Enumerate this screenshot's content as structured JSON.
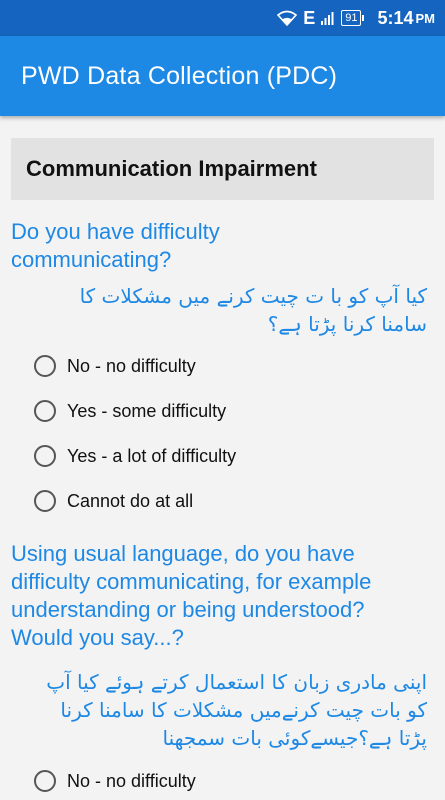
{
  "status_bar": {
    "network": "E",
    "battery": "91",
    "time": "5:14",
    "time_suffix": "PM"
  },
  "app_bar": {
    "title": "PWD Data Collection (PDC)"
  },
  "section": {
    "title": "Communication Impairment"
  },
  "questions": [
    {
      "text_line1": "Do you have difficulty",
      "text_line2": "communicating?",
      "urdu_line1": "کیا آپ کو با ت چیت کرنے میں مشکلات کا",
      "urdu_line2": "سامنا کرنا پڑتا ہے؟",
      "options": [
        "No - no difficulty",
        "Yes - some difficulty",
        "Yes - a lot of difficulty",
        "Cannot do at all"
      ]
    },
    {
      "text_line1": "Using usual language, do you have",
      "text_line2": "difficulty communicating, for example",
      "text_line3": "understanding or being understood?",
      "text_line4": "Would you say...?",
      "urdu_line1": "اپنی مادری زبان کا استعمال کرتے ہوئے کیا آپ",
      "urdu_line2": "کو بات چیت کرنےمیں مشکلات کا سامنا کرنا",
      "urdu_line3": "پڑتا ہے؟جیسےکوئی بات سمجھنا",
      "options": [
        "No - no difficulty"
      ]
    }
  ],
  "colors": {
    "status_bar": "#1565c0",
    "app_bar": "#1e88e5",
    "question_text": "#1e88e5",
    "section_bg": "#e2e2e2",
    "page_bg": "#f3f3f3"
  },
  "icons": [
    "wifi-icon",
    "signal-icon",
    "battery-icon",
    "radio-unchecked-icon"
  ]
}
